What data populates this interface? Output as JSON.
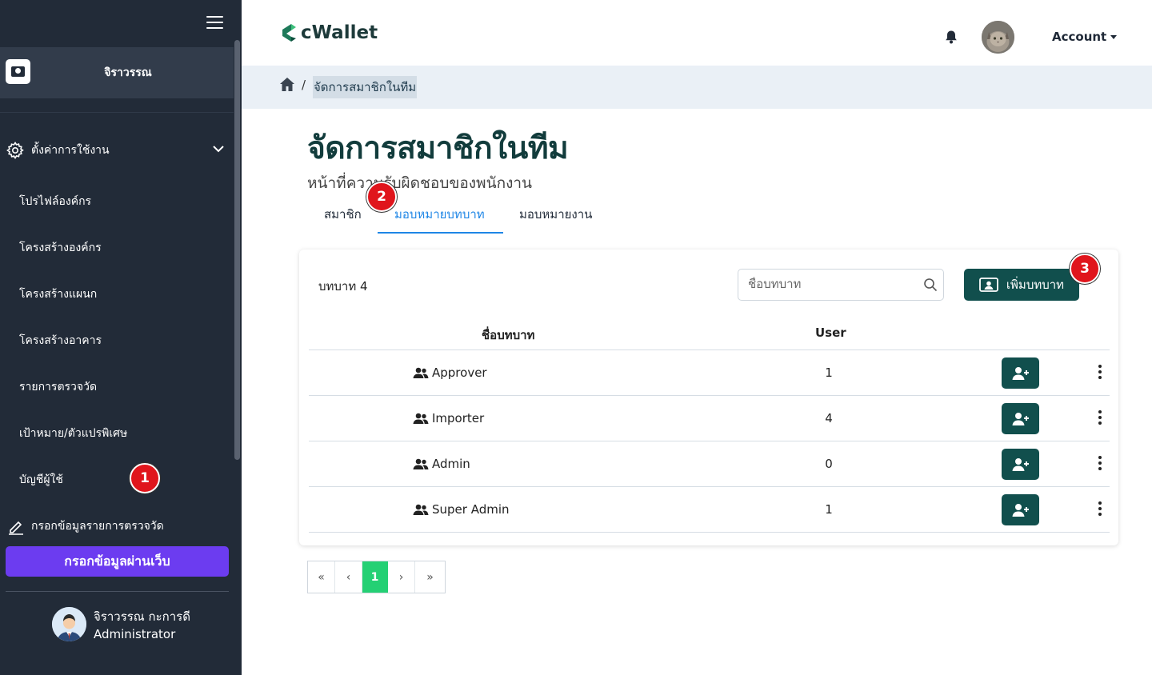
{
  "sidebar": {
    "org_name": "จิราวรรณ",
    "settings_label": "ตั้งค่าการใช้งาน",
    "sub_items": [
      {
        "label": "โปรไฟล์องค์กร"
      },
      {
        "label": "โครงสร้างองค์กร"
      },
      {
        "label": "โครงสร้างแผนก"
      },
      {
        "label": "โครงสร้างอาคาร"
      },
      {
        "label": "รายการตรวจวัด"
      },
      {
        "label": "เป้าหมาย/ตัวแปรพิเศษ"
      },
      {
        "label": "บัญชีผู้ใช้"
      }
    ],
    "fill_label": "กรอกข้อมูลรายการตรวจวัด",
    "web_button": "กรอกข้อมูลผ่านเว็บ",
    "user": {
      "name": "จิราวรรณ กะการดี",
      "role": "Administrator"
    }
  },
  "header": {
    "brand": "cWallet",
    "account_label": "Account",
    "icons": {
      "bell": "bell-icon",
      "caret": "caret-down-icon"
    }
  },
  "breadcrumb": {
    "separator": "/",
    "current": "จัดการสมาชิกในทีม"
  },
  "page": {
    "title": "จัดการสมาชิกในทีม",
    "subtitle": "หน้าที่ความรับผิดชอบของพนักงาน",
    "tabs": [
      {
        "label": "สมาชิก"
      },
      {
        "label": "มอบหมายบทบาท"
      },
      {
        "label": "มอบหมายงาน"
      }
    ]
  },
  "roles": {
    "count_label": "บทบาท 4",
    "search_placeholder": "ชื่อบทบาท",
    "add_button": "เพิ่มบทบาท",
    "columns": {
      "name": "ชื่อบทบาท",
      "user": "User"
    },
    "rows": [
      {
        "name": "Approver",
        "users": "1"
      },
      {
        "name": "Importer",
        "users": "4"
      },
      {
        "name": "Admin",
        "users": "0"
      },
      {
        "name": "Super Admin",
        "users": "1"
      }
    ]
  },
  "pagination": {
    "first": "«",
    "prev": "‹",
    "current": "1",
    "next": "›",
    "last": "»"
  },
  "annotations": {
    "marker_1": "1",
    "marker_2": "2",
    "marker_3": "3"
  },
  "colors": {
    "sidebar_bg": "#222b38",
    "primary_teal": "#114f4d",
    "accent_purple": "#6c3cf0",
    "tab_active": "#1e86e6",
    "page_active": "#24d074",
    "marker_red": "#e0151c"
  }
}
